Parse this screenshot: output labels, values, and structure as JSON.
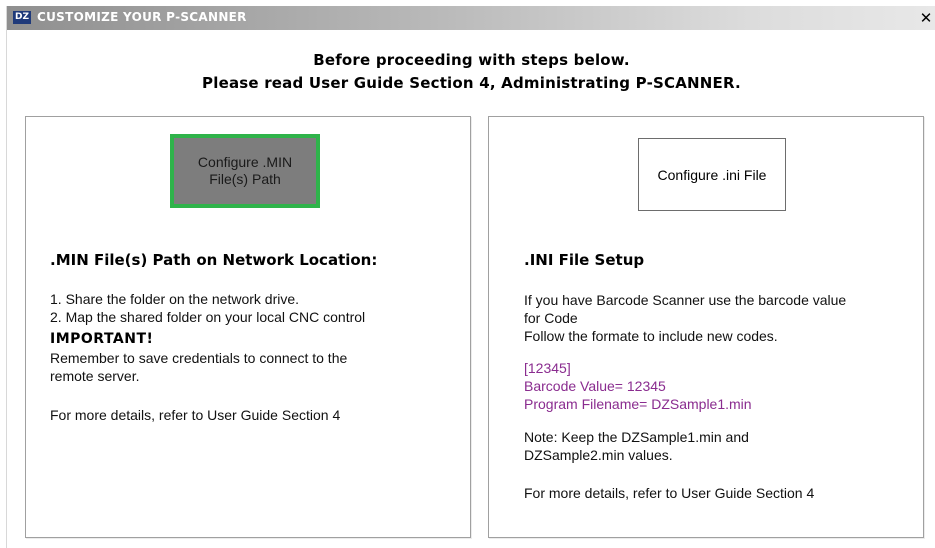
{
  "window": {
    "icon_text": "DZ",
    "title": "CUSTOMIZE YOUR P-SCANNER",
    "close_glyph": "✕"
  },
  "instructions": {
    "line1": "Before proceeding with steps below.",
    "line2": "Please read User Guide Section 4, Administrating P-SCANNER."
  },
  "min_panel": {
    "button_label": "Configure .MIN File(s) Path",
    "heading": ".MIN File(s) Path on Network Location:",
    "step1": "1. Share the folder on the network drive.",
    "step2": "2. Map the shared folder on your local CNC control",
    "important": "IMPORTANT!",
    "note_line1": "Remember to save credentials to connect to the",
    "note_line2": "remote server.",
    "footer": "For more details, refer to User Guide Section 4"
  },
  "ini_panel": {
    "button_label": "Configure .ini File",
    "heading": ".INI File Setup",
    "desc_line1": "If you have Barcode Scanner use the barcode value",
    "desc_line2": "for Code",
    "desc_line3": "Follow the formate to include new codes.",
    "example_line1": "[12345]",
    "example_line2": "Barcode Value= 12345",
    "example_line3": "Program Filename= DZSample1.min",
    "note_line1": "Note: Keep the DZSample1.min and",
    "note_line2": "DZSample2.min values.",
    "footer": "For more details, refer to User Guide Section 4"
  },
  "colors": {
    "highlight_border": "#2fb34a",
    "active_button_bg": "#7d7d7d",
    "example_text": "#8a2c8f"
  }
}
